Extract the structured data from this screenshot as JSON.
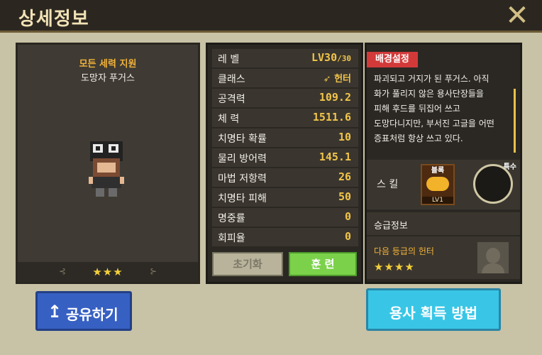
{
  "title": "상세정보",
  "close_icon": "close-x-icon",
  "hero": {
    "faction": "모든 세력 지원",
    "name": "도망자 푸거스",
    "stars": "★★★",
    "deco_left": "⊰",
    "deco_right": "⊱"
  },
  "stats": {
    "level_label": "레 벨",
    "level_value": "LV30",
    "level_max": "/30",
    "class_label": "클래스",
    "class_value": "헌터",
    "rows": [
      {
        "label": "공격력",
        "value": "109.2"
      },
      {
        "label": "체 력",
        "value": "1511.6"
      },
      {
        "label": "치명타 확률",
        "value": "10"
      },
      {
        "label": "물리 방어력",
        "value": "145.1"
      },
      {
        "label": "마법 저항력",
        "value": "26"
      },
      {
        "label": "치명타 피해",
        "value": "50"
      },
      {
        "label": "명중률",
        "value": "0"
      },
      {
        "label": "회피율",
        "value": "0"
      }
    ],
    "reset_label": "초기화",
    "train_label": "훈 련"
  },
  "background": {
    "tag": "배경설정",
    "lines": [
      "파괴되고 거지가 된 푸거스. 아직",
      "화가 풀리지 않은 용사단장들을",
      "피해 후드를 뒤집어 쓰고",
      "도망다니지만, 부서진 고글을 어떤",
      "증표처럼 항상 쓰고 있다."
    ]
  },
  "skills": {
    "label": "스 킬",
    "skill1_tag": "블록",
    "skill1_level": "LV1",
    "skill2_tag": "특수"
  },
  "promotion": {
    "label": "승급정보",
    "next": "다음 등급의 헌터",
    "stars": "★★★★"
  },
  "buttons": {
    "share_icon": "↥",
    "share": "공유하기",
    "how_to_get": "용사 획득 방법"
  }
}
